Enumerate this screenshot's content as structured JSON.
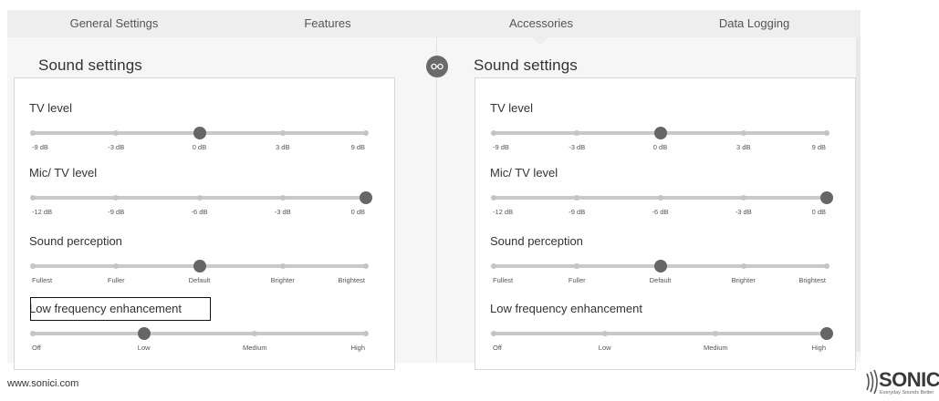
{
  "tabs": [
    {
      "label": "General Settings"
    },
    {
      "label": "Features"
    },
    {
      "label": "Accessories"
    },
    {
      "label": "Data Logging"
    }
  ],
  "active_tab": "Accessories",
  "panels": [
    {
      "title": "Sound settings",
      "settings": [
        {
          "label": "TV level",
          "ticks": [
            "-9 dB",
            "-3 dB",
            "0 dB",
            "3 dB",
            "9 dB"
          ],
          "selected": "0 dB"
        },
        {
          "label": "Mic/ TV level",
          "ticks": [
            "-12 dB",
            "-9 dB",
            "-6 dB",
            "-3 dB",
            "0 dB"
          ],
          "selected": "0 dB"
        },
        {
          "label": "Sound perception",
          "ticks": [
            "Fullest",
            "Fuller",
            "Default",
            "Brighter",
            "Brightest"
          ],
          "selected": "Default"
        },
        {
          "label": "Low frequency enhancement",
          "ticks": [
            "Off",
            "Low",
            "Medium",
            "High"
          ],
          "selected": "Low"
        }
      ]
    },
    {
      "title": "Sound settings",
      "settings": [
        {
          "label": "TV level",
          "ticks": [
            "-9 dB",
            "-3 dB",
            "0 dB",
            "3 dB",
            "9 dB"
          ],
          "selected": "0 dB"
        },
        {
          "label": "Mic/ TV level",
          "ticks": [
            "-12 dB",
            "-9 dB",
            "-6 dB",
            "-3 dB",
            "0 dB"
          ],
          "selected": "0 dB"
        },
        {
          "label": "Sound perception",
          "ticks": [
            "Fullest",
            "Fuller",
            "Default",
            "Brighter",
            "Brightest"
          ],
          "selected": "Default"
        },
        {
          "label": "Low frequency enhancement",
          "ticks": [
            "Off",
            "Low",
            "Medium",
            "High"
          ],
          "selected": "High"
        }
      ]
    }
  ],
  "link_icon": "link-icon",
  "footer": {
    "url": "www.sonici.com"
  },
  "logo": {
    "name": "SONIC",
    "tagline": "Everyday Sounds Better"
  },
  "colors": {
    "tab_bg": "#eeeeee",
    "panel_bg": "#f6f6f6",
    "thumb": "#666666",
    "track": "#c9c9c9"
  }
}
